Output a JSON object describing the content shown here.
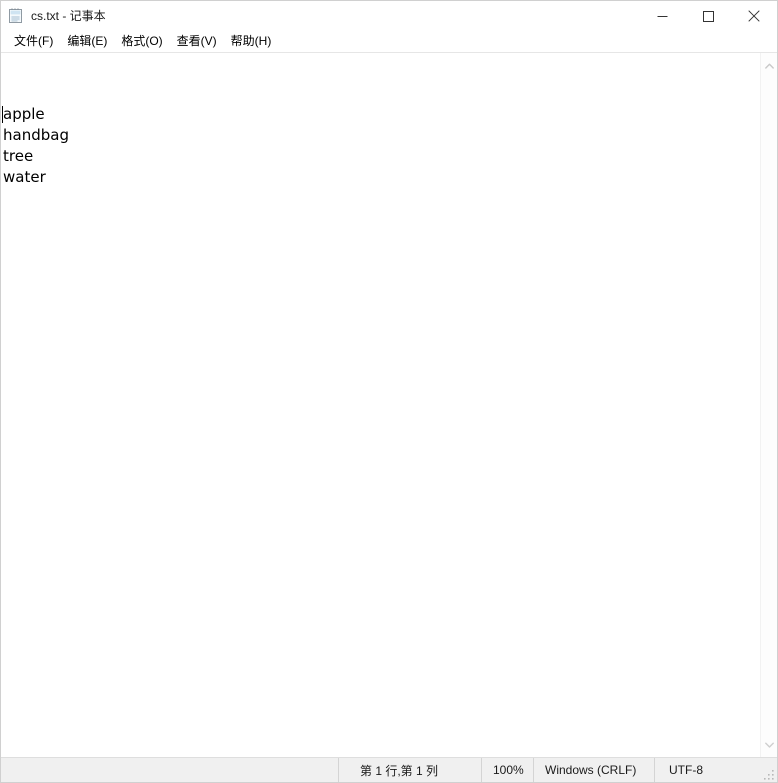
{
  "window": {
    "title": "cs.txt - 记事本",
    "icon": "notepad-icon"
  },
  "controls": {
    "minimize_label": "最小化",
    "maximize_label": "最大化",
    "close_label": "关闭"
  },
  "menubar": {
    "items": [
      {
        "label": "文件(F)",
        "name": "menu-file"
      },
      {
        "label": "编辑(E)",
        "name": "menu-edit"
      },
      {
        "label": "格式(O)",
        "name": "menu-format"
      },
      {
        "label": "查看(V)",
        "name": "menu-view"
      },
      {
        "label": "帮助(H)",
        "name": "menu-help"
      }
    ]
  },
  "editor": {
    "lines": [
      "apple",
      "handbag",
      "tree",
      "water"
    ],
    "caret_line": 1,
    "caret_column": 1
  },
  "scrollbar": {
    "up_arrow": "chevron-up-icon",
    "down_arrow": "chevron-down-icon"
  },
  "statusbar": {
    "position": "第 1 行,第 1 列",
    "zoom": "100%",
    "line_ending": "Windows (CRLF)",
    "encoding": "UTF-8"
  },
  "colors": {
    "window_bg": "#ffffff",
    "titlebar_bg": "#ffffff",
    "statusbar_bg": "#f0f0f0",
    "text": "#000000",
    "border": "#d0d0d0"
  }
}
